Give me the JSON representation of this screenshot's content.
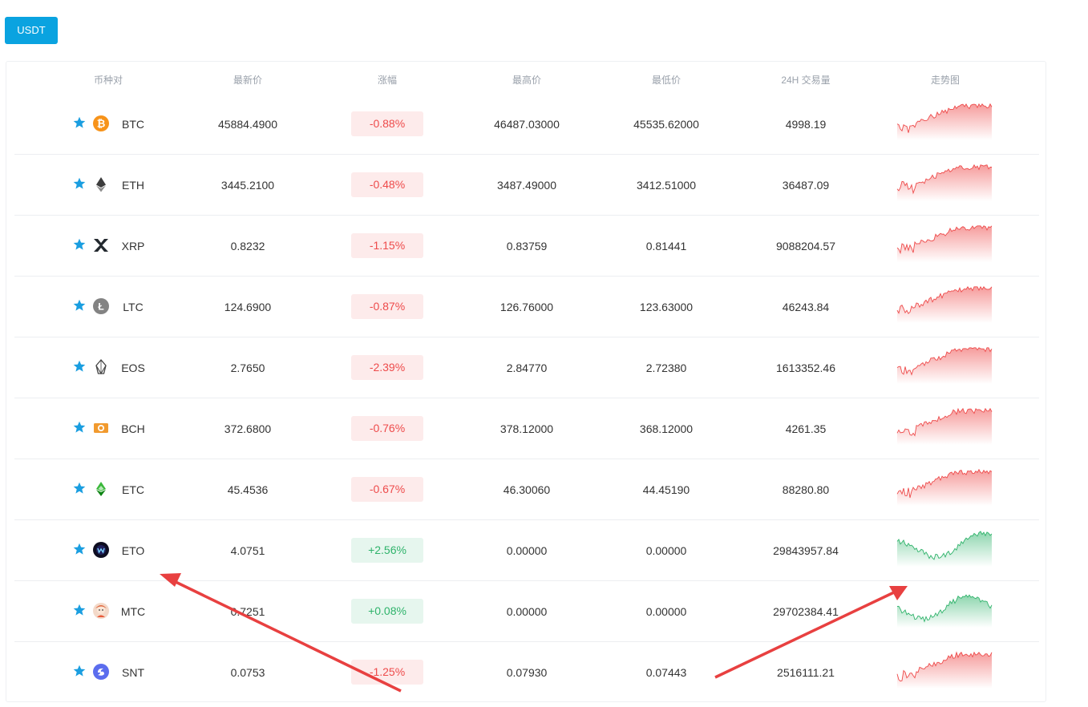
{
  "tabs": [
    {
      "label": "USDT"
    }
  ],
  "header": {
    "pair": "币种对",
    "last": "最新价",
    "change": "涨幅",
    "high": "最高价",
    "low": "最低价",
    "volume": "24H 交易量",
    "trend": "走势图"
  },
  "colors": {
    "accent": "#0aa3e0",
    "down": "#ee4b4b",
    "up": "#2fb36b",
    "annotation": "#e84040"
  },
  "rows": [
    {
      "symbol": "BTC",
      "icon": "bitcoin-icon",
      "last": "45884.4900",
      "change": "-0.88%",
      "dir": "down",
      "high": "46487.03000",
      "low": "45535.62000",
      "volume": "4998.19",
      "seed": 1
    },
    {
      "symbol": "ETH",
      "icon": "ethereum-icon",
      "last": "3445.2100",
      "change": "-0.48%",
      "dir": "down",
      "high": "3487.49000",
      "low": "3412.51000",
      "volume": "36487.09",
      "seed": 2
    },
    {
      "symbol": "XRP",
      "icon": "xrp-icon",
      "last": "0.8232",
      "change": "-1.15%",
      "dir": "down",
      "high": "0.83759",
      "low": "0.81441",
      "volume": "9088204.57",
      "seed": 3
    },
    {
      "symbol": "LTC",
      "icon": "litecoin-icon",
      "last": "124.6900",
      "change": "-0.87%",
      "dir": "down",
      "high": "126.76000",
      "low": "123.63000",
      "volume": "46243.84",
      "seed": 4
    },
    {
      "symbol": "EOS",
      "icon": "eos-icon",
      "last": "2.7650",
      "change": "-2.39%",
      "dir": "down",
      "high": "2.84770",
      "low": "2.72380",
      "volume": "1613352.46",
      "seed": 5
    },
    {
      "symbol": "BCH",
      "icon": "bitcoin-cash-icon",
      "last": "372.6800",
      "change": "-0.76%",
      "dir": "down",
      "high": "378.12000",
      "low": "368.12000",
      "volume": "4261.35",
      "seed": 6
    },
    {
      "symbol": "ETC",
      "icon": "ethereum-classic-icon",
      "last": "45.4536",
      "change": "-0.67%",
      "dir": "down",
      "high": "46.30060",
      "low": "44.45190",
      "volume": "88280.80",
      "seed": 7
    },
    {
      "symbol": "ETO",
      "icon": "eto-icon",
      "last": "4.0751",
      "change": "+2.56%",
      "dir": "up",
      "high": "0.00000",
      "low": "0.00000",
      "volume": "29843957.84",
      "seed": 8
    },
    {
      "symbol": "MTC",
      "icon": "mtc-avatar-icon",
      "last": "0.7251",
      "change": "+0.08%",
      "dir": "up",
      "high": "0.00000",
      "low": "0.00000",
      "volume": "29702384.41",
      "seed": 9
    },
    {
      "symbol": "SNT",
      "icon": "snt-icon",
      "last": "0.0753",
      "change": "-1.25%",
      "dir": "down",
      "high": "0.07930",
      "low": "0.07443",
      "volume": "2516111.21",
      "seed": 10
    }
  ]
}
